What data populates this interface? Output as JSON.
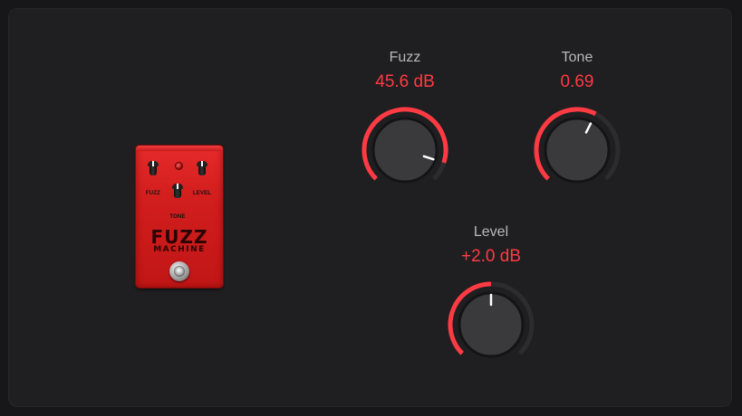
{
  "pedal": {
    "labels": {
      "fuzz": "FUZZ",
      "level": "LEVEL",
      "tone": "TONE"
    },
    "brand_line1": "FUZZ",
    "brand_line2": "MACHINE"
  },
  "params": {
    "fuzz": {
      "label": "Fuzz",
      "value": "45.6 dB",
      "level": 0.9
    },
    "tone": {
      "label": "Tone",
      "value": "0.69",
      "level": 0.6
    },
    "level": {
      "label": "Level",
      "value": "+2.0 dB",
      "level": 0.5
    }
  },
  "colors": {
    "accent": "#ff3a43",
    "track": "#2c2c2e",
    "background": "#1f1f21"
  }
}
